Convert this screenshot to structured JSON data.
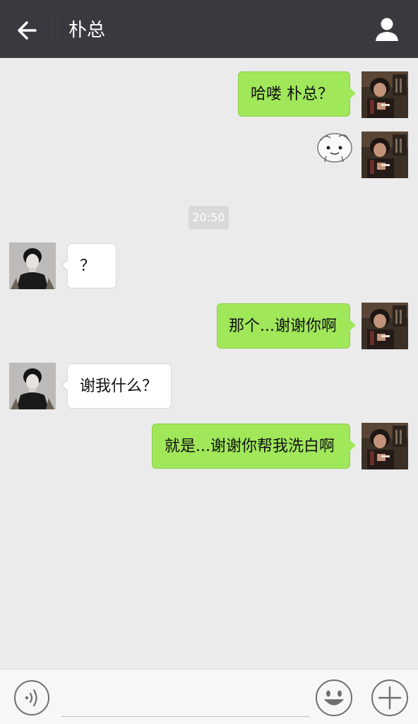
{
  "header": {
    "title": "朴总",
    "back_icon": "arrow-left-icon",
    "contact_icon": "person-icon"
  },
  "messages": [
    {
      "sender": "me",
      "text": "哈喽  朴总？"
    },
    {
      "sender": "me",
      "sticker": "cartoon-sticker"
    },
    {
      "sender": "them",
      "text": "？"
    },
    {
      "sender": "me",
      "text": "那个...谢谢你啊"
    },
    {
      "sender": "them",
      "text": "谢我什么？"
    },
    {
      "sender": "me",
      "text": "就是...谢谢你帮我洗白啊"
    }
  ],
  "timestamp": "20:50",
  "input_bar": {
    "voice_icon": "voice-icon",
    "text_value": "",
    "emoji_icon": "emoji-icon",
    "plus_icon": "plus-icon"
  },
  "colors": {
    "header_bg": "#393a3f",
    "chat_bg": "#ebebeb",
    "my_bubble": "#a0e75a",
    "their_bubble": "#ffffff"
  }
}
